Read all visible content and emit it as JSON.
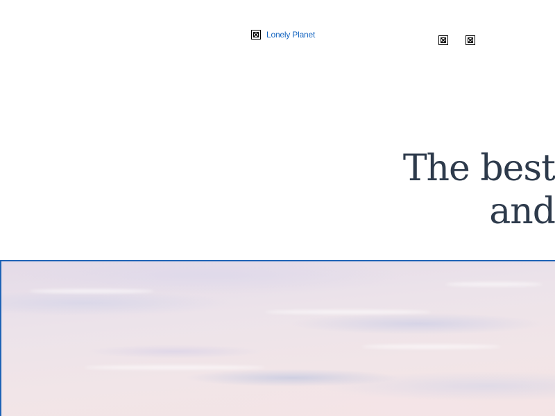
{
  "header": {
    "logo_alt": "Lonely Planet",
    "nav_icons": [
      "broken-image-icon",
      "broken-image-icon"
    ]
  },
  "hero": {
    "title_line1": "The best",
    "title_line2": "and"
  },
  "colors": {
    "link": "#1565c0",
    "title": "#2d3a4b",
    "hero_border": "#1e63b6"
  }
}
